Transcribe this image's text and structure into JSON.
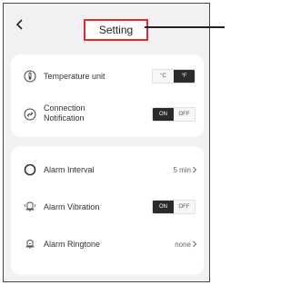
{
  "header": {
    "title": "Setting"
  },
  "card1": {
    "temperature_unit": {
      "label": "Temperature unit",
      "options": [
        "°C",
        "°F"
      ],
      "selected": "°F"
    },
    "connection_notification": {
      "label_line1": "Connection",
      "label_line2": "Notification",
      "options": [
        "ON",
        "OFF"
      ],
      "selected": "ON"
    }
  },
  "card2": {
    "alarm_interval": {
      "label": "Alarm Interval",
      "value": "5 min"
    },
    "alarm_vibration": {
      "label": "Alarm Vibration",
      "options": [
        "ON",
        "OFF"
      ],
      "selected": "ON"
    },
    "alarm_ringtone": {
      "label": "Alarm Ringtone",
      "value": "none"
    }
  },
  "icons": [
    "back-icon",
    "thermometer-icon",
    "link-icon",
    "clock-icon",
    "vibration-icon",
    "bell-icon",
    "chevron-right-icon"
  ],
  "colors": {
    "highlight": "#e8292b",
    "toggle_active": "#2b2b2b"
  }
}
